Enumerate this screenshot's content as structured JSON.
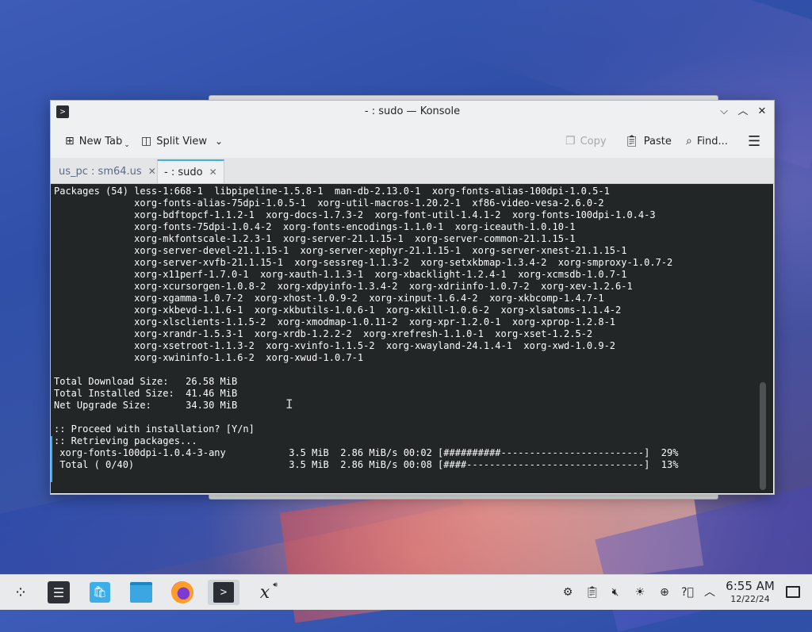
{
  "window": {
    "title": "- : sudo — Konsole",
    "controls": {
      "minimize": "⌵",
      "maximize": "︿",
      "close": "✕"
    }
  },
  "toolbar": {
    "new_tab": "New Tab",
    "split_view": "Split View",
    "copy": "Copy",
    "paste": "Paste",
    "find": "Find...",
    "menu_icon": "☰"
  },
  "tabs": [
    {
      "label": "us_pc : sm64.us",
      "active": false
    },
    {
      "label": "- : sudo",
      "active": true
    }
  ],
  "terminal": {
    "lines": [
      "Packages (54) less-1:668-1  libpipeline-1.5.8-1  man-db-2.13.0-1  xorg-fonts-alias-100dpi-1.0.5-1",
      "              xorg-fonts-alias-75dpi-1.0.5-1  xorg-util-macros-1.20.2-1  xf86-video-vesa-2.6.0-2",
      "              xorg-bdftopcf-1.1.2-1  xorg-docs-1.7.3-2  xorg-font-util-1.4.1-2  xorg-fonts-100dpi-1.0.4-3",
      "              xorg-fonts-75dpi-1.0.4-2  xorg-fonts-encodings-1.1.0-1  xorg-iceauth-1.0.10-1",
      "              xorg-mkfontscale-1.2.3-1  xorg-server-21.1.15-1  xorg-server-common-21.1.15-1",
      "              xorg-server-devel-21.1.15-1  xorg-server-xephyr-21.1.15-1  xorg-server-xnest-21.1.15-1",
      "              xorg-server-xvfb-21.1.15-1  xorg-sessreg-1.1.3-2  xorg-setxkbmap-1.3.4-2  xorg-smproxy-1.0.7-2",
      "              xorg-x11perf-1.7.0-1  xorg-xauth-1.1.3-1  xorg-xbacklight-1.2.4-1  xorg-xcmsdb-1.0.7-1",
      "              xorg-xcursorgen-1.0.8-2  xorg-xdpyinfo-1.3.4-2  xorg-xdriinfo-1.0.7-2  xorg-xev-1.2.6-1",
      "              xorg-xgamma-1.0.7-2  xorg-xhost-1.0.9-2  xorg-xinput-1.6.4-2  xorg-xkbcomp-1.4.7-1",
      "              xorg-xkbevd-1.1.6-1  xorg-xkbutils-1.0.6-1  xorg-xkill-1.0.6-2  xorg-xlsatoms-1.1.4-2",
      "              xorg-xlsclients-1.1.5-2  xorg-xmodmap-1.0.11-2  xorg-xpr-1.2.0-1  xorg-xprop-1.2.8-1",
      "              xorg-xrandr-1.5.3-1  xorg-xrdb-1.2.2-2  xorg-xrefresh-1.1.0-1  xorg-xset-1.2.5-2",
      "              xorg-xsetroot-1.1.3-2  xorg-xvinfo-1.1.5-2  xorg-xwayland-24.1.4-1  xorg-xwd-1.0.9-2",
      "              xorg-xwininfo-1.1.6-2  xorg-xwud-1.0.7-1",
      "",
      "Total Download Size:   26.58 MiB",
      "Total Installed Size:  41.46 MiB",
      "Net Upgrade Size:      34.30 MiB",
      "",
      ":: Proceed with installation? [Y/n]",
      ":: Retrieving packages...",
      " xorg-fonts-100dpi-1.0.4-3-any           3.5 MiB  2.86 MiB/s 00:02 [##########-------------------------]  29%",
      " Total ( 0/40)                           3.5 MiB  2.86 MiB/s 00:08 [####-------------------------------]  13%"
    ],
    "progress": {
      "current_package_percent": 29,
      "total_percent": 13
    }
  },
  "taskbar": {
    "apps": [
      {
        "name": "application-launcher"
      },
      {
        "name": "system-settings"
      },
      {
        "name": "discover-store"
      },
      {
        "name": "dolphin-files"
      },
      {
        "name": "firefox"
      },
      {
        "name": "konsole",
        "active": true
      },
      {
        "name": "x-app"
      }
    ],
    "clock": {
      "time": "6:55 AM",
      "date": "12/22/24"
    }
  }
}
